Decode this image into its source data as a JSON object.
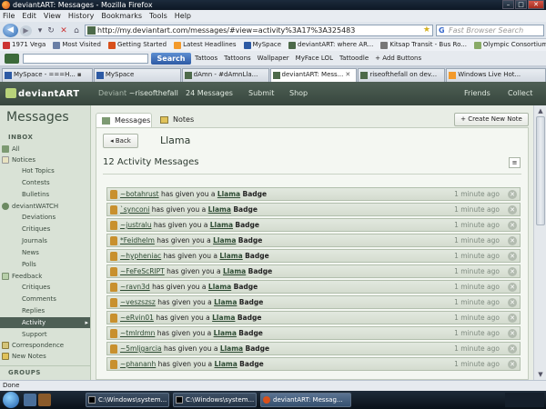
{
  "browser": {
    "title": "deviantART: Messages - Mozilla Firefox",
    "menu": [
      "File",
      "Edit",
      "View",
      "History",
      "Bookmarks",
      "Tools",
      "Help"
    ],
    "url": "http://my.deviantart.com/messages/#view=activity%3A17%3A325483",
    "search_placeholder": "Fast Browser Search",
    "bookmarks": [
      "1971 Vega",
      "Most Visited",
      "Getting Started",
      "Latest Headlines",
      "MySpace",
      "deviantART: where AR...",
      "Kitsap Transit - Bus Ro...",
      "Olympic Consortium -..."
    ],
    "toolbar_search_label": "Search",
    "toolbar_links": [
      "Tattoos",
      "Tattoons",
      "Wallpaper",
      "MyFace LOL",
      "Tattoodle",
      "+ Add Buttons"
    ],
    "tabs": [
      {
        "label": "MySpace - ===H...",
        "extra": "▪"
      },
      {
        "label": "MySpace",
        "extra": ""
      },
      {
        "label": "dAmn - #dAmnLla...",
        "extra": ""
      },
      {
        "label": "deviantART: Mess...",
        "extra": "✕"
      },
      {
        "label": "riseofthefall on dev...",
        "extra": ""
      },
      {
        "label": "Windows Live Hot...",
        "extra": ""
      }
    ],
    "status": "Done"
  },
  "da": {
    "logo": "deviantART",
    "user": "Deviant",
    "username": "~riseofthefall",
    "messages": "24 Messages",
    "submit": "Submit",
    "shop": "Shop",
    "friends": "Friends",
    "collect": "Collect"
  },
  "sidebar": {
    "title": "Messages",
    "inbox_head": "INBOX",
    "groups_head": "GROUPS",
    "items": [
      "All",
      "Notices",
      "Hot Topics",
      "Contests",
      "Bulletins",
      "deviantWATCH",
      "Deviations",
      "Critiques",
      "Journals",
      "News",
      "Polls",
      "Feedback",
      "Critiques",
      "Comments",
      "Replies",
      "Activity",
      "Support",
      "Correspondence",
      "New Notes"
    ]
  },
  "main": {
    "tab_messages": "Messages",
    "tab_notes": "Notes",
    "create_note": "+ Create New Note",
    "back": "◂ Back",
    "page_title": "Llama",
    "activity_head": "12 Activity Messages",
    "msg_middle": "has given you a",
    "llama": "Llama",
    "badge": "Badge",
    "time": "1 minute ago",
    "messages": [
      {
        "user": "~botahrust"
      },
      {
        "user": "`synconi"
      },
      {
        "user": "~justralu"
      },
      {
        "user": "*Feidhelm"
      },
      {
        "user": "~hypheniac"
      },
      {
        "user": "~FeFeScRIPT"
      },
      {
        "user": "~ravn3d"
      },
      {
        "user": "~veszszsz"
      },
      {
        "user": "~eRvin01"
      },
      {
        "user": "~tmlrdmn"
      },
      {
        "user": "~5mljgarcia"
      },
      {
        "user": "~phananh"
      }
    ]
  },
  "taskbar": {
    "tasks": [
      "C:\\Windows\\system...",
      "C:\\Windows\\system...",
      "deviantART: Messag..."
    ]
  }
}
